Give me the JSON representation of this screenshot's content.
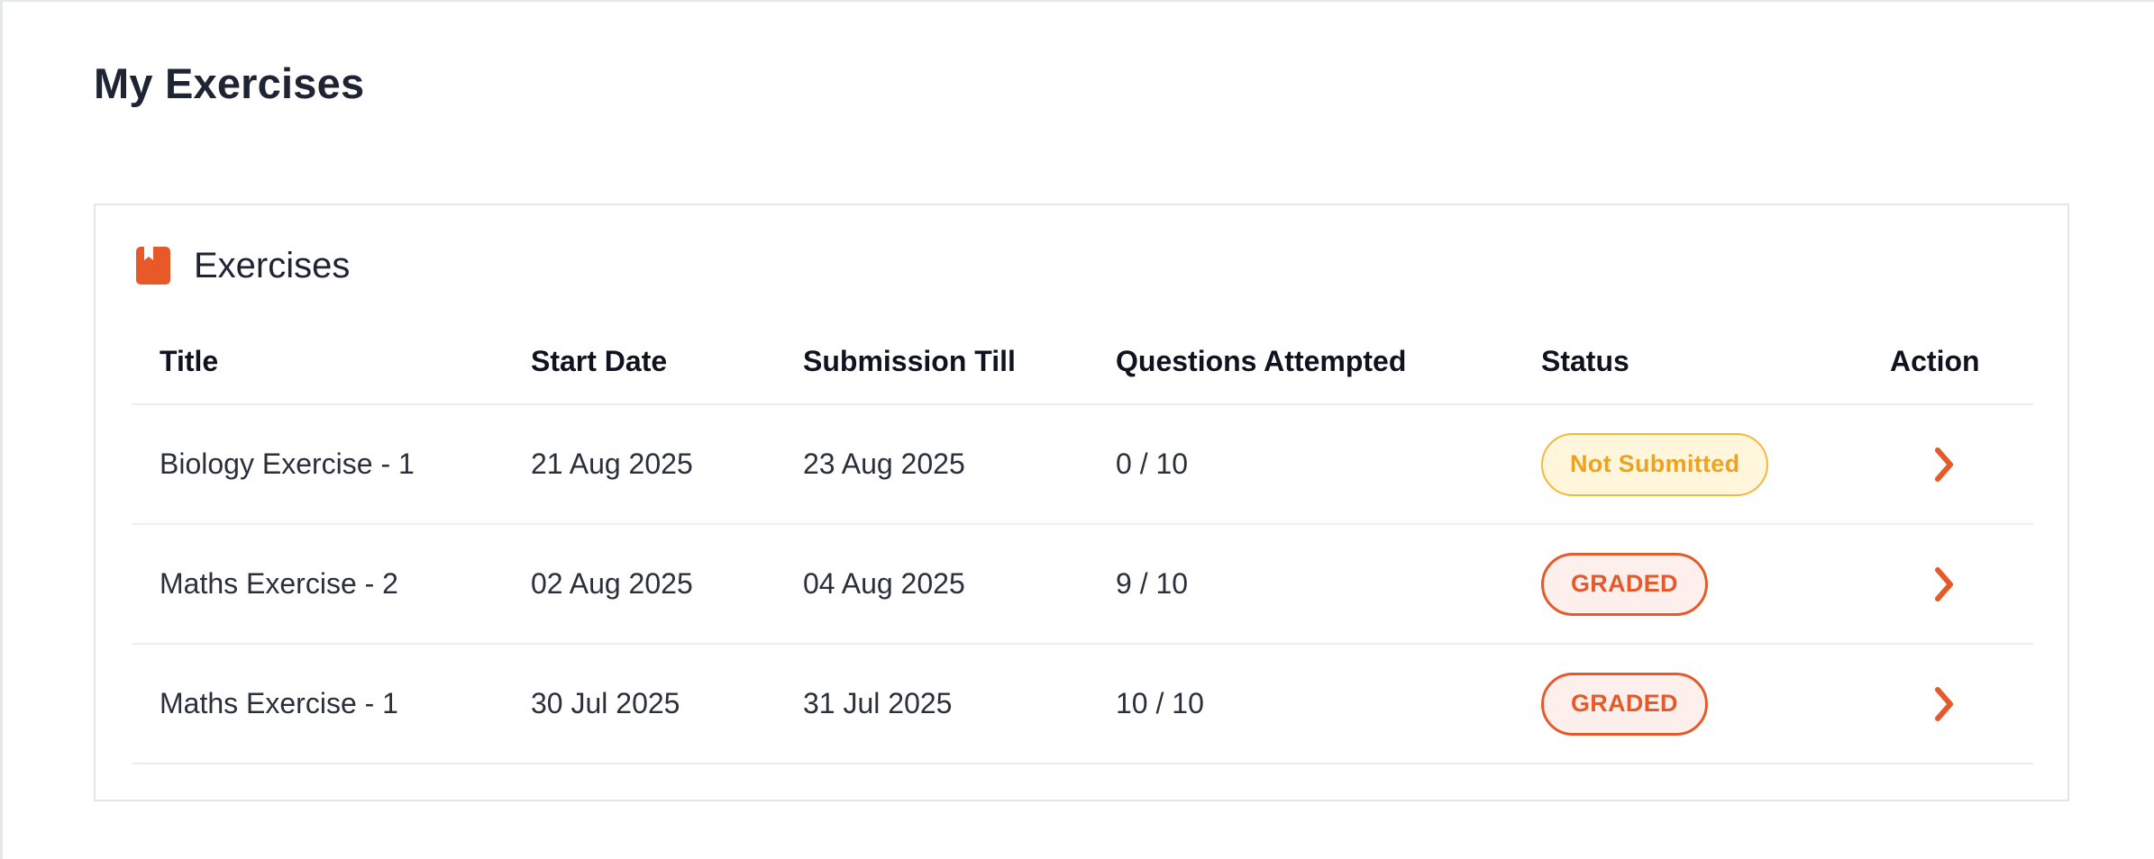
{
  "page": {
    "title": "My Exercises"
  },
  "card": {
    "title": "Exercises",
    "icon": "book-icon",
    "accent_color": "#e8592a"
  },
  "table": {
    "headers": {
      "title": "Title",
      "start_date": "Start Date",
      "submission_till": "Submission Till",
      "questions_attempted": "Questions Attempted",
      "status": "Status",
      "action": "Action"
    },
    "rows": [
      {
        "title": "Biology Exercise - 1",
        "start_date": "21 Aug 2025",
        "submission_till": "23 Aug 2025",
        "questions_attempted": "0 / 10",
        "status": "Not Submitted",
        "status_type": "pending",
        "action_icon": "chevron-right-icon"
      },
      {
        "title": "Maths Exercise - 2",
        "start_date": "02 Aug 2025",
        "submission_till": "04 Aug 2025",
        "questions_attempted": "9 / 10",
        "status": "GRADED",
        "status_type": "graded",
        "action_icon": "chevron-right-icon"
      },
      {
        "title": "Maths Exercise - 1",
        "start_date": "30 Jul 2025",
        "submission_till": "31 Jul 2025",
        "questions_attempted": "10 / 10",
        "status": "GRADED",
        "status_type": "graded",
        "action_icon": "chevron-right-icon"
      }
    ]
  },
  "colors": {
    "pending_text": "#eea21f",
    "pending_bg": "#fff6dc",
    "graded_text": "#e55a2b",
    "graded_bg": "#fdf0ec"
  }
}
